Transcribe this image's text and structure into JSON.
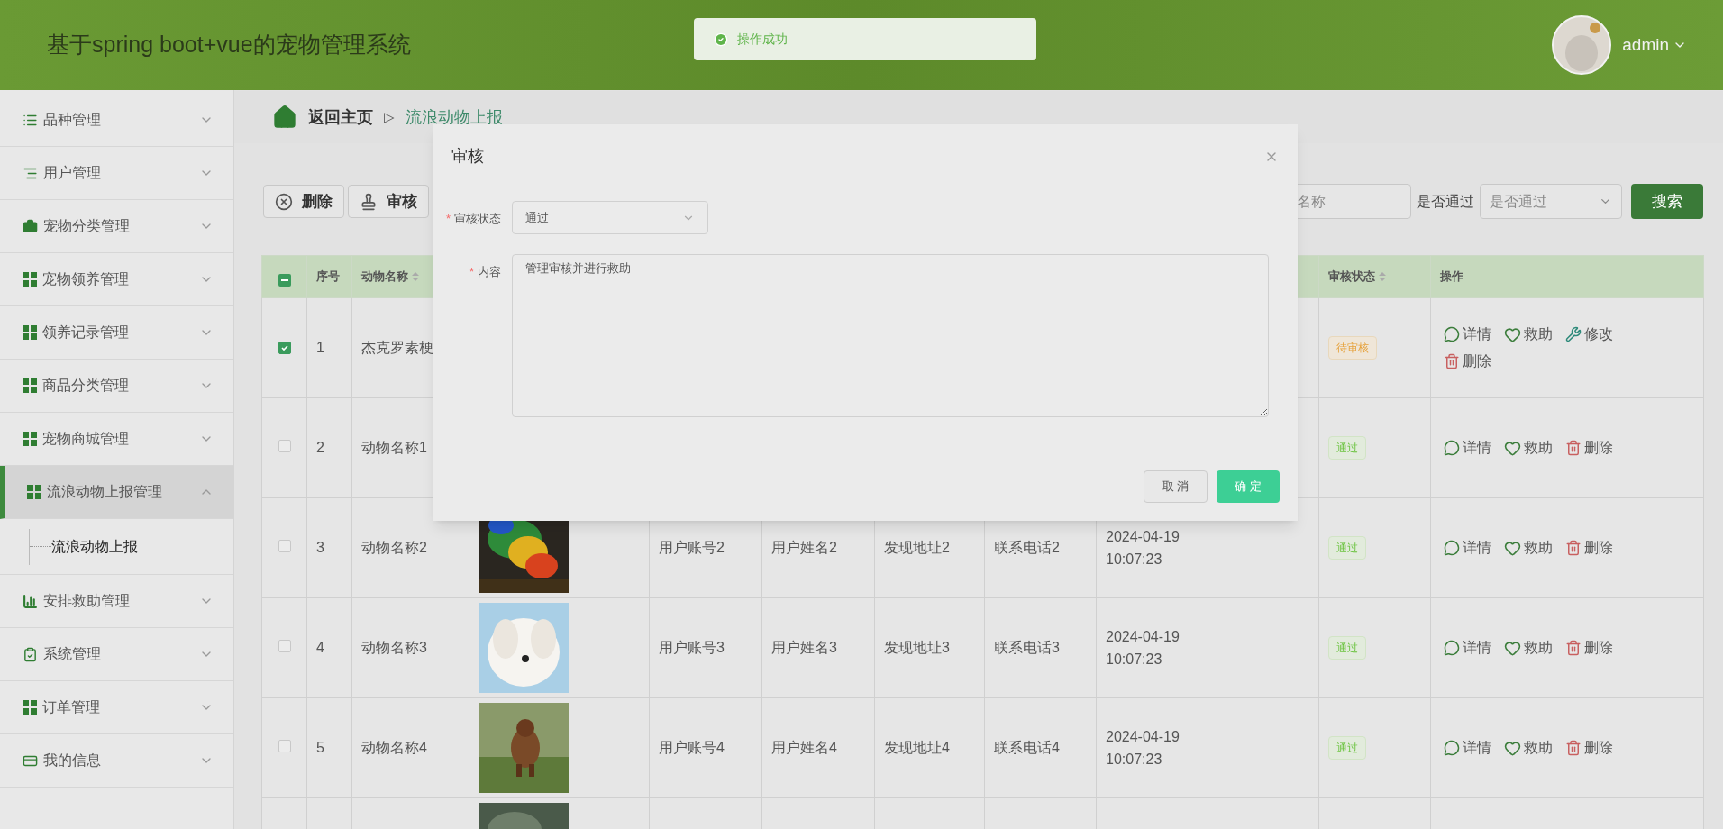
{
  "header": {
    "title": "基于spring boot+vue的宠物管理系统",
    "user": "admin"
  },
  "toast": {
    "message": "操作成功"
  },
  "sidebar": {
    "items": [
      {
        "label": "品种管理",
        "kind": "list",
        "expanded": false,
        "selected": false
      },
      {
        "label": "用户管理",
        "kind": "lines",
        "expanded": false,
        "selected": false
      },
      {
        "label": "宠物分类管理",
        "kind": "briefcase",
        "expanded": false,
        "selected": false
      },
      {
        "label": "宠物领养管理",
        "kind": "grid",
        "expanded": false,
        "selected": false
      },
      {
        "label": "领养记录管理",
        "kind": "grid",
        "expanded": false,
        "selected": false
      },
      {
        "label": "商品分类管理",
        "kind": "grid",
        "expanded": false,
        "selected": false
      },
      {
        "label": "宠物商城管理",
        "kind": "grid",
        "expanded": false,
        "selected": false
      },
      {
        "label": "流浪动物上报管理",
        "kind": "grid",
        "expanded": true,
        "selected": true,
        "children": [
          {
            "label": "流浪动物上报",
            "selected": true
          }
        ]
      },
      {
        "label": "安排救助管理",
        "kind": "chart",
        "expanded": false,
        "selected": false
      },
      {
        "label": "系统管理",
        "kind": "clipboard",
        "expanded": false,
        "selected": false
      },
      {
        "label": "订单管理",
        "kind": "grid",
        "expanded": false,
        "selected": false
      },
      {
        "label": "我的信息",
        "kind": "card",
        "expanded": false,
        "selected": false
      }
    ]
  },
  "breadcrumb": {
    "home": "返回主页",
    "separator": "▷",
    "current": "流浪动物上报"
  },
  "toolbar": {
    "buttons": [
      {
        "label": "删除",
        "kind": "delete"
      },
      {
        "label": "审核",
        "kind": "review"
      }
    ],
    "search": {
      "placeholder": "名称"
    },
    "filter": {
      "label": "是否通过",
      "placeholder": "是否通过"
    },
    "search_button": "搜索"
  },
  "table": {
    "select_all": {
      "indeterminate": true
    },
    "columns": [
      {
        "label": "序号",
        "sortable": false
      },
      {
        "label": "动物名称",
        "sortable": true
      },
      {
        "label": "审核状态",
        "sortable": true
      },
      {
        "label": "操作",
        "sortable": false
      }
    ],
    "rows": [
      {
        "selected": true,
        "index": "1",
        "name": "杰克罗素梗",
        "status": {
          "label": "待审核",
          "kind": "pending"
        },
        "actions": [
          {
            "label": "详情",
            "kind": "detail"
          },
          {
            "label": "救助",
            "kind": "rescue"
          },
          {
            "label": "修改",
            "kind": "edit"
          },
          {
            "label": "删除",
            "kind": "delete"
          }
        ]
      },
      {
        "selected": false,
        "index": "2",
        "name": "动物名称1",
        "status": {
          "label": "通过",
          "kind": "approved"
        },
        "actions": [
          {
            "label": "详情",
            "kind": "detail"
          },
          {
            "label": "救助",
            "kind": "rescue"
          },
          {
            "label": "删除",
            "kind": "delete"
          }
        ]
      },
      {
        "selected": false,
        "index": "3",
        "name": "动物名称2",
        "image": {
          "kind": "picture"
        },
        "account": "用户账号2",
        "user_name": "用户姓名2",
        "address": "发现地址2",
        "phone": "联系电话2",
        "time": "2024-04-19 10:07:23",
        "status": {
          "label": "通过",
          "kind": "approved"
        },
        "actions": [
          {
            "label": "详情",
            "kind": "detail"
          },
          {
            "label": "救助",
            "kind": "rescue"
          },
          {
            "label": "删除",
            "kind": "delete"
          }
        ]
      },
      {
        "selected": false,
        "index": "4",
        "name": "动物名称3",
        "image": {
          "kind": "picture"
        },
        "account": "用户账号3",
        "user_name": "用户姓名3",
        "address": "发现地址3",
        "phone": "联系电话3",
        "time": "2024-04-19 10:07:23",
        "status": {
          "label": "通过",
          "kind": "approved"
        },
        "actions": [
          {
            "label": "详情",
            "kind": "detail"
          },
          {
            "label": "救助",
            "kind": "rescue"
          },
          {
            "label": "删除",
            "kind": "delete"
          }
        ]
      },
      {
        "selected": false,
        "index": "5",
        "name": "动物名称4",
        "image": {
          "kind": "picture"
        },
        "account": "用户账号4",
        "user_name": "用户姓名4",
        "address": "发现地址4",
        "phone": "联系电话4",
        "time": "2024-04-19 10:07:23",
        "status": {
          "label": "通过",
          "kind": "approved"
        },
        "actions": [
          {
            "label": "详情",
            "kind": "detail"
          },
          {
            "label": "救助",
            "kind": "rescue"
          },
          {
            "label": "删除",
            "kind": "delete"
          }
        ]
      },
      {
        "image": {
          "kind": "picture"
        }
      }
    ]
  },
  "dialog": {
    "title": "审核",
    "fields": [
      {
        "kind": "select",
        "label": "审核状态",
        "required": true,
        "required_mark": "*",
        "value": "通过"
      },
      {
        "kind": "textarea",
        "label": "内容",
        "required": true,
        "required_mark": "*",
        "value": "管理审核并进行救助"
      }
    ],
    "buttons": [
      {
        "label": "取 消",
        "kind": "cancel"
      },
      {
        "label": "确 定",
        "kind": "primary"
      }
    ]
  }
}
